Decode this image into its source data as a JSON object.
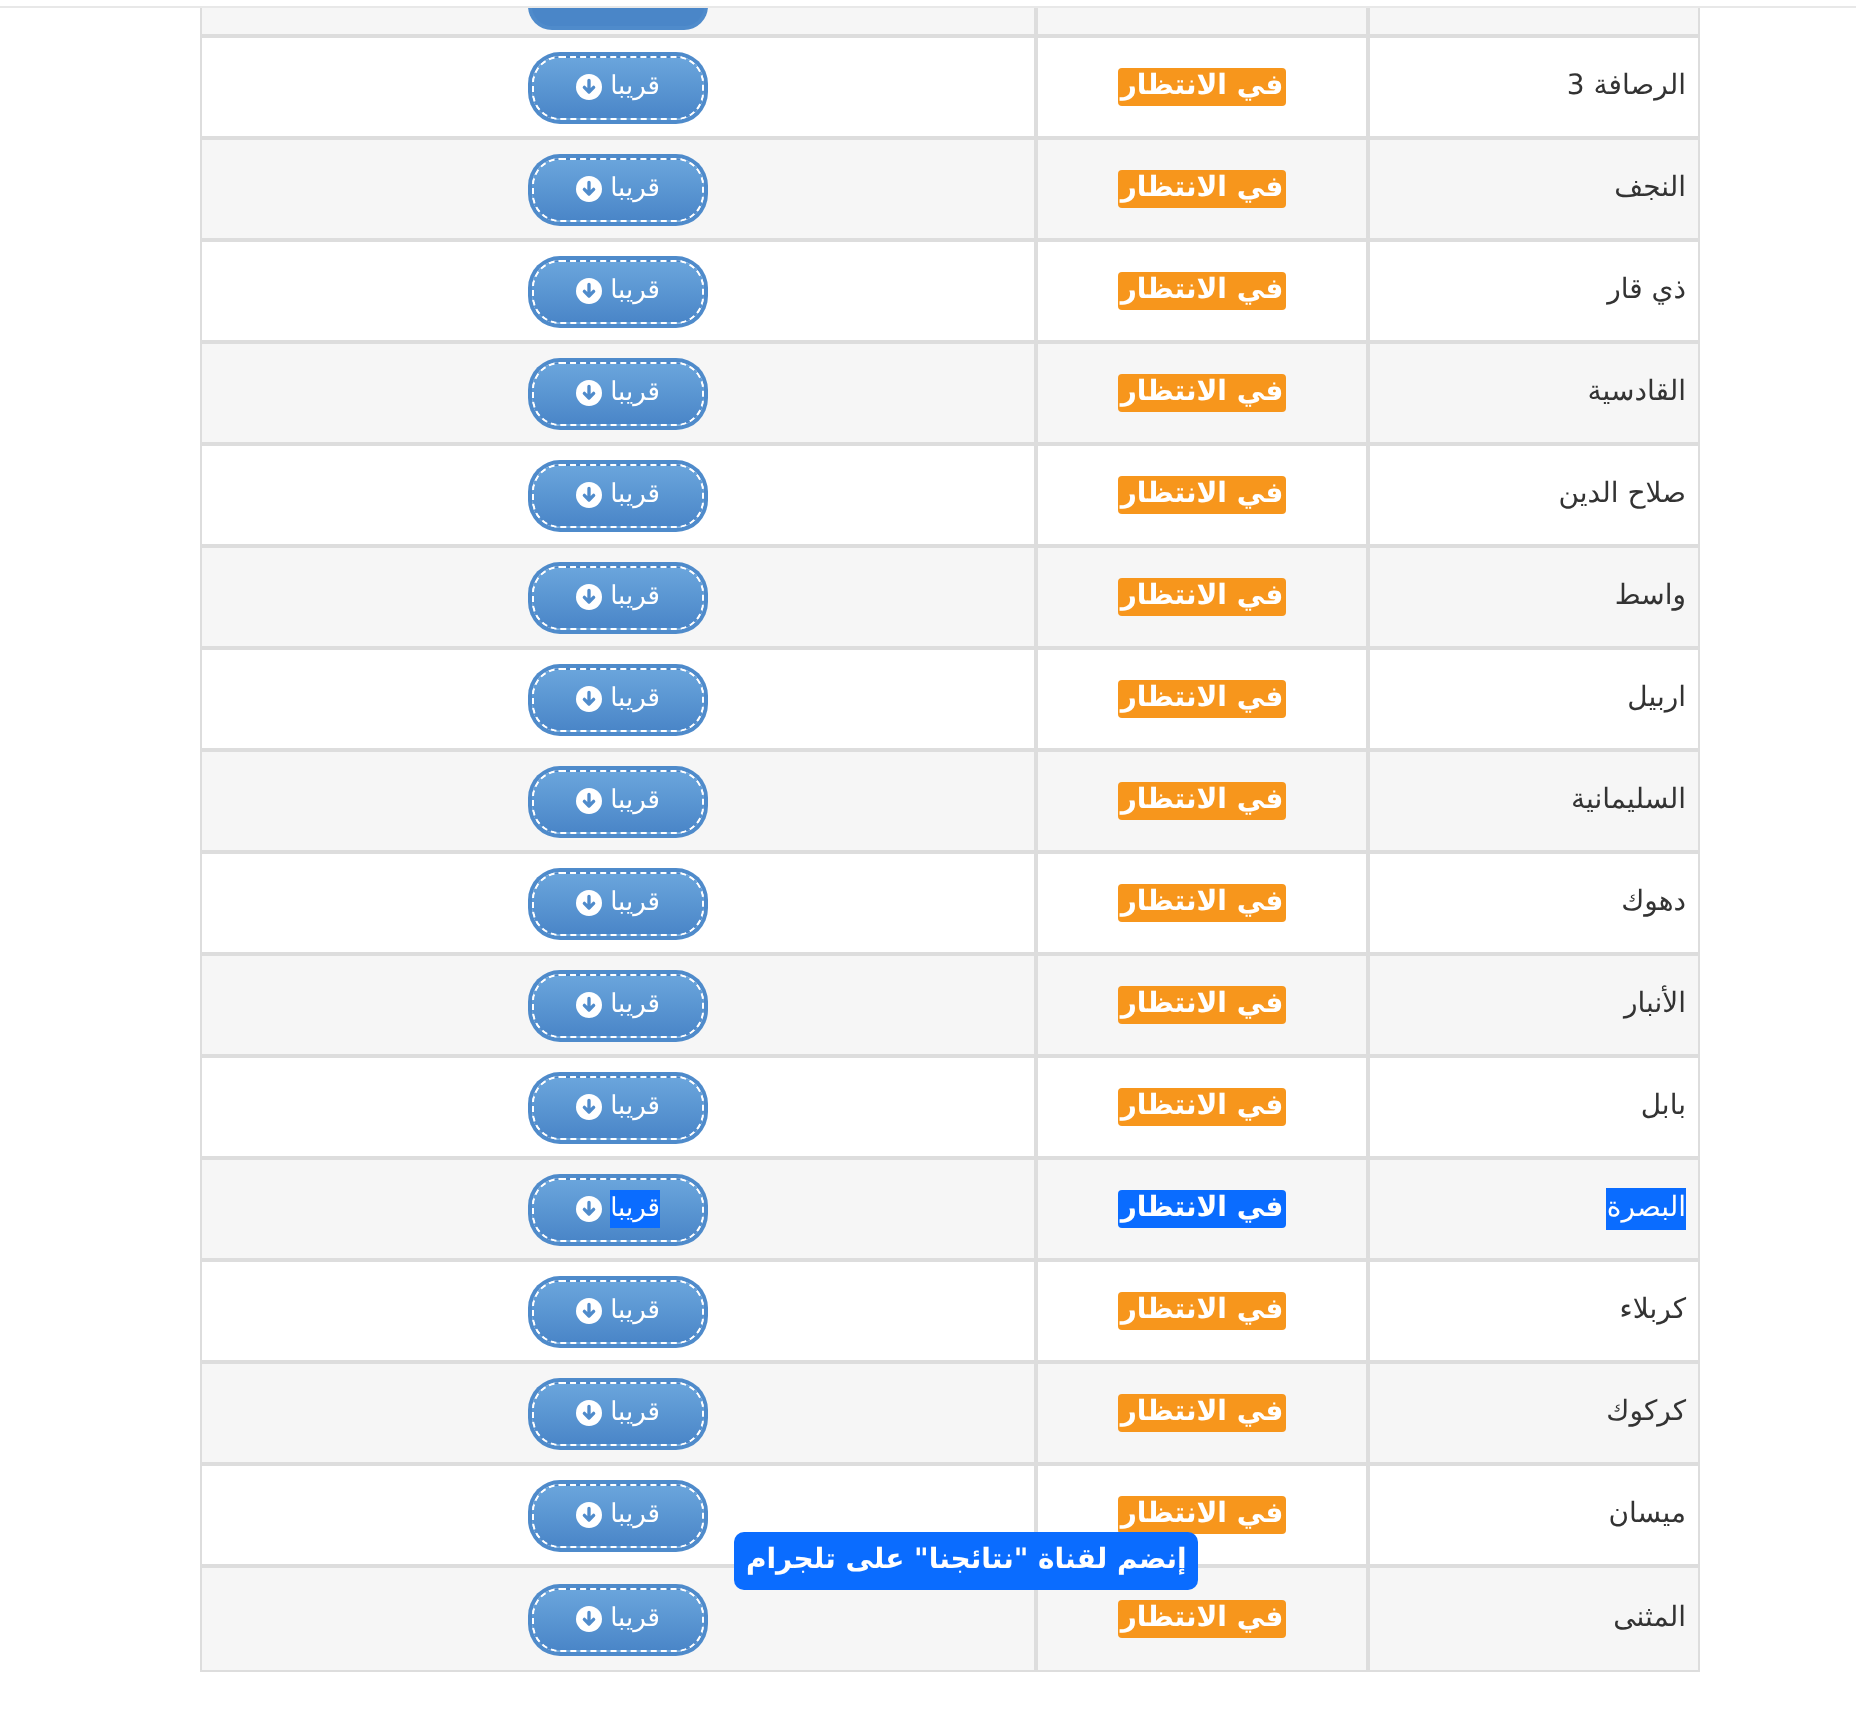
{
  "rows": [
    {
      "name": "الرصافة 3",
      "status": "في الانتظار",
      "action": "قريبا",
      "selected": false
    },
    {
      "name": "النجف",
      "status": "في الانتظار",
      "action": "قريبا",
      "selected": false
    },
    {
      "name": "ذي قار",
      "status": "في الانتظار",
      "action": "قريبا",
      "selected": false
    },
    {
      "name": "القادسية",
      "status": "في الانتظار",
      "action": "قريبا",
      "selected": false
    },
    {
      "name": "صلاح الدين",
      "status": "في الانتظار",
      "action": "قريبا",
      "selected": false
    },
    {
      "name": "واسط",
      "status": "في الانتظار",
      "action": "قريبا",
      "selected": false
    },
    {
      "name": "اربيل",
      "status": "في الانتظار",
      "action": "قريبا",
      "selected": false
    },
    {
      "name": "السليمانية",
      "status": "في الانتظار",
      "action": "قريبا",
      "selected": false
    },
    {
      "name": "دهوك",
      "status": "في الانتظار",
      "action": "قريبا",
      "selected": false
    },
    {
      "name": "الأنبار",
      "status": "في الانتظار",
      "action": "قريبا",
      "selected": false
    },
    {
      "name": "بابل",
      "status": "في الانتظار",
      "action": "قريبا",
      "selected": false
    },
    {
      "name": "البصرة",
      "status": "في الانتظار",
      "action": "قريبا",
      "selected": true
    },
    {
      "name": "كربلاء",
      "status": "في الانتظار",
      "action": "قريبا",
      "selected": false
    },
    {
      "name": "كركوك",
      "status": "في الانتظار",
      "action": "قريبا",
      "selected": false
    },
    {
      "name": "ميسان",
      "status": "في الانتظار",
      "action": "قريبا",
      "selected": false
    },
    {
      "name": "المثنى",
      "status": "في الانتظار",
      "action": "قريبا",
      "selected": false
    }
  ],
  "banner": {
    "text": "إنضم لقناة \"نتائجنا\" على تلجرام"
  }
}
